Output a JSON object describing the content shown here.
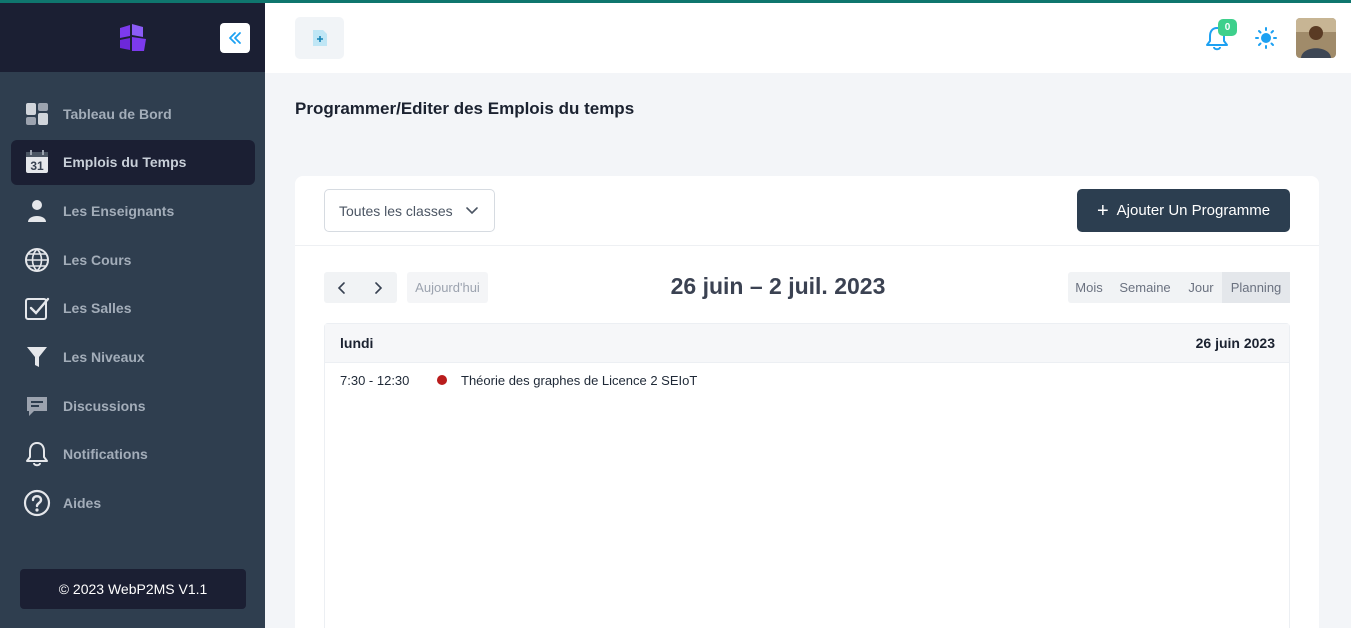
{
  "app": {
    "accent": "#0f766e",
    "footer": "© 2023 WebP2MS V1.1"
  },
  "sidebar": {
    "items": [
      {
        "label": "Tableau de Bord",
        "icon": "dashboard-icon"
      },
      {
        "label": "Emplois du Temps",
        "icon": "calendar-icon",
        "badge": "31",
        "active": true
      },
      {
        "label": "Les Enseignants",
        "icon": "user-icon"
      },
      {
        "label": "Les Cours",
        "icon": "globe-icon"
      },
      {
        "label": "Les Salles",
        "icon": "checkbox-icon"
      },
      {
        "label": "Les Niveaux",
        "icon": "filter-icon"
      },
      {
        "label": "Discussions",
        "icon": "chat-icon"
      },
      {
        "label": "Notifications",
        "icon": "bell-icon"
      },
      {
        "label": "Aides",
        "icon": "help-icon"
      }
    ]
  },
  "topbar": {
    "notification_count": "0"
  },
  "page": {
    "title": "Programmer/Editer des Emplois du temps"
  },
  "toolbar": {
    "class_select_value": "Toutes les classes",
    "add_button_label": "Ajouter Un Programme"
  },
  "calendar": {
    "today_label": "Aujourd'hui",
    "range_title": "26 juin – 2 juil. 2023",
    "views": [
      "Mois",
      "Semaine",
      "Jour",
      "Planning"
    ],
    "active_view": "Planning",
    "day": {
      "name": "lundi",
      "date": "26 juin 2023"
    },
    "events": [
      {
        "time": "7:30 - 12:30",
        "title": "Théorie des graphes de Licence 2 SEIoT",
        "color": "#b91c1c"
      }
    ]
  }
}
